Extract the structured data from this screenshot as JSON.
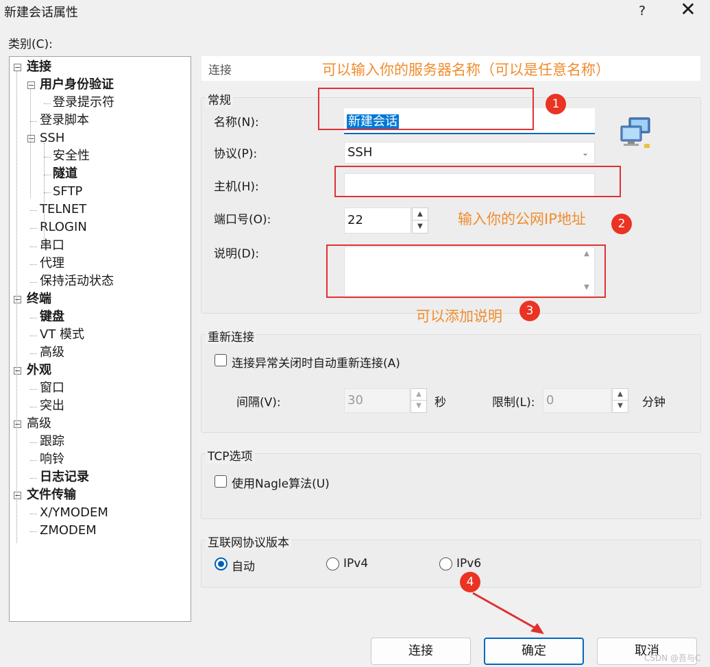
{
  "window": {
    "title": "新建会话属性",
    "help": "?",
    "close": "✕"
  },
  "category_label": "类别(C):",
  "tree": [
    {
      "label": "连接",
      "bold": true,
      "expander": "−"
    },
    {
      "label": "用户身份验证",
      "bold": true,
      "expander": "−"
    },
    {
      "label": "登录提示符",
      "bold": false
    },
    {
      "label": "登录脚本",
      "bold": false
    },
    {
      "label": "SSH",
      "bold": false,
      "expander": "−"
    },
    {
      "label": "安全性",
      "bold": false
    },
    {
      "label": "隧道",
      "bold": true
    },
    {
      "label": "SFTP",
      "bold": false
    },
    {
      "label": "TELNET",
      "bold": false
    },
    {
      "label": "RLOGIN",
      "bold": false
    },
    {
      "label": "串口",
      "bold": false
    },
    {
      "label": "代理",
      "bold": false
    },
    {
      "label": "保持活动状态",
      "bold": false
    },
    {
      "label": "终端",
      "bold": true,
      "expander": "−"
    },
    {
      "label": "键盘",
      "bold": true
    },
    {
      "label": "VT 模式",
      "bold": false
    },
    {
      "label": "高级",
      "bold": false
    },
    {
      "label": "外观",
      "bold": true,
      "expander": "−"
    },
    {
      "label": "窗口",
      "bold": false
    },
    {
      "label": "突出",
      "bold": false
    },
    {
      "label": "高级",
      "bold": false,
      "expander": "−"
    },
    {
      "label": "跟踪",
      "bold": false
    },
    {
      "label": "响铃",
      "bold": false
    },
    {
      "label": "日志记录",
      "bold": true
    },
    {
      "label": "文件传输",
      "bold": true,
      "expander": "−"
    },
    {
      "label": "X/YMODEM",
      "bold": false
    },
    {
      "label": "ZMODEM",
      "bold": false
    }
  ],
  "header": {
    "title": "连接"
  },
  "general": {
    "title": "常规",
    "name_label": "名称(N):",
    "name_value": "新建会话",
    "protocol_label": "协议(P):",
    "protocol_value": "SSH",
    "host_label": "主机(H):",
    "host_value": "",
    "port_label": "端口号(O):",
    "port_value": "22",
    "desc_label": "说明(D):",
    "desc_value": ""
  },
  "reconnect": {
    "title": "重新连接",
    "checkbox_label": "连接异常关闭时自动重新连接(A)",
    "checked": false,
    "interval_label": "间隔(V):",
    "interval_value": "30",
    "seconds_unit": "秒",
    "limit_label": "限制(L):",
    "limit_value": "0",
    "minutes_unit": "分钟"
  },
  "tcp": {
    "title": "TCP选项",
    "nagle_label": "使用Nagle算法(U)",
    "checked": false
  },
  "ip_version": {
    "title": "互联网协议版本",
    "options": [
      "自动",
      "IPv4",
      "IPv6"
    ],
    "selected": "自动"
  },
  "buttons": {
    "connect": "连接",
    "ok": "确定",
    "cancel": "取消"
  },
  "annotations": {
    "name_hint": "可以输入你的服务器名称（可以是任意名称）",
    "host_hint": "输入你的公网IP地址",
    "desc_hint": "可以添加说明",
    "step1": "1",
    "step2": "2",
    "step3": "3",
    "step4": "4"
  },
  "watermark": "CSDN @吾与C",
  "colors": {
    "accent": "#0067c0",
    "annotation_red": "#e03131",
    "annotation_orange": "#f08c2e"
  }
}
